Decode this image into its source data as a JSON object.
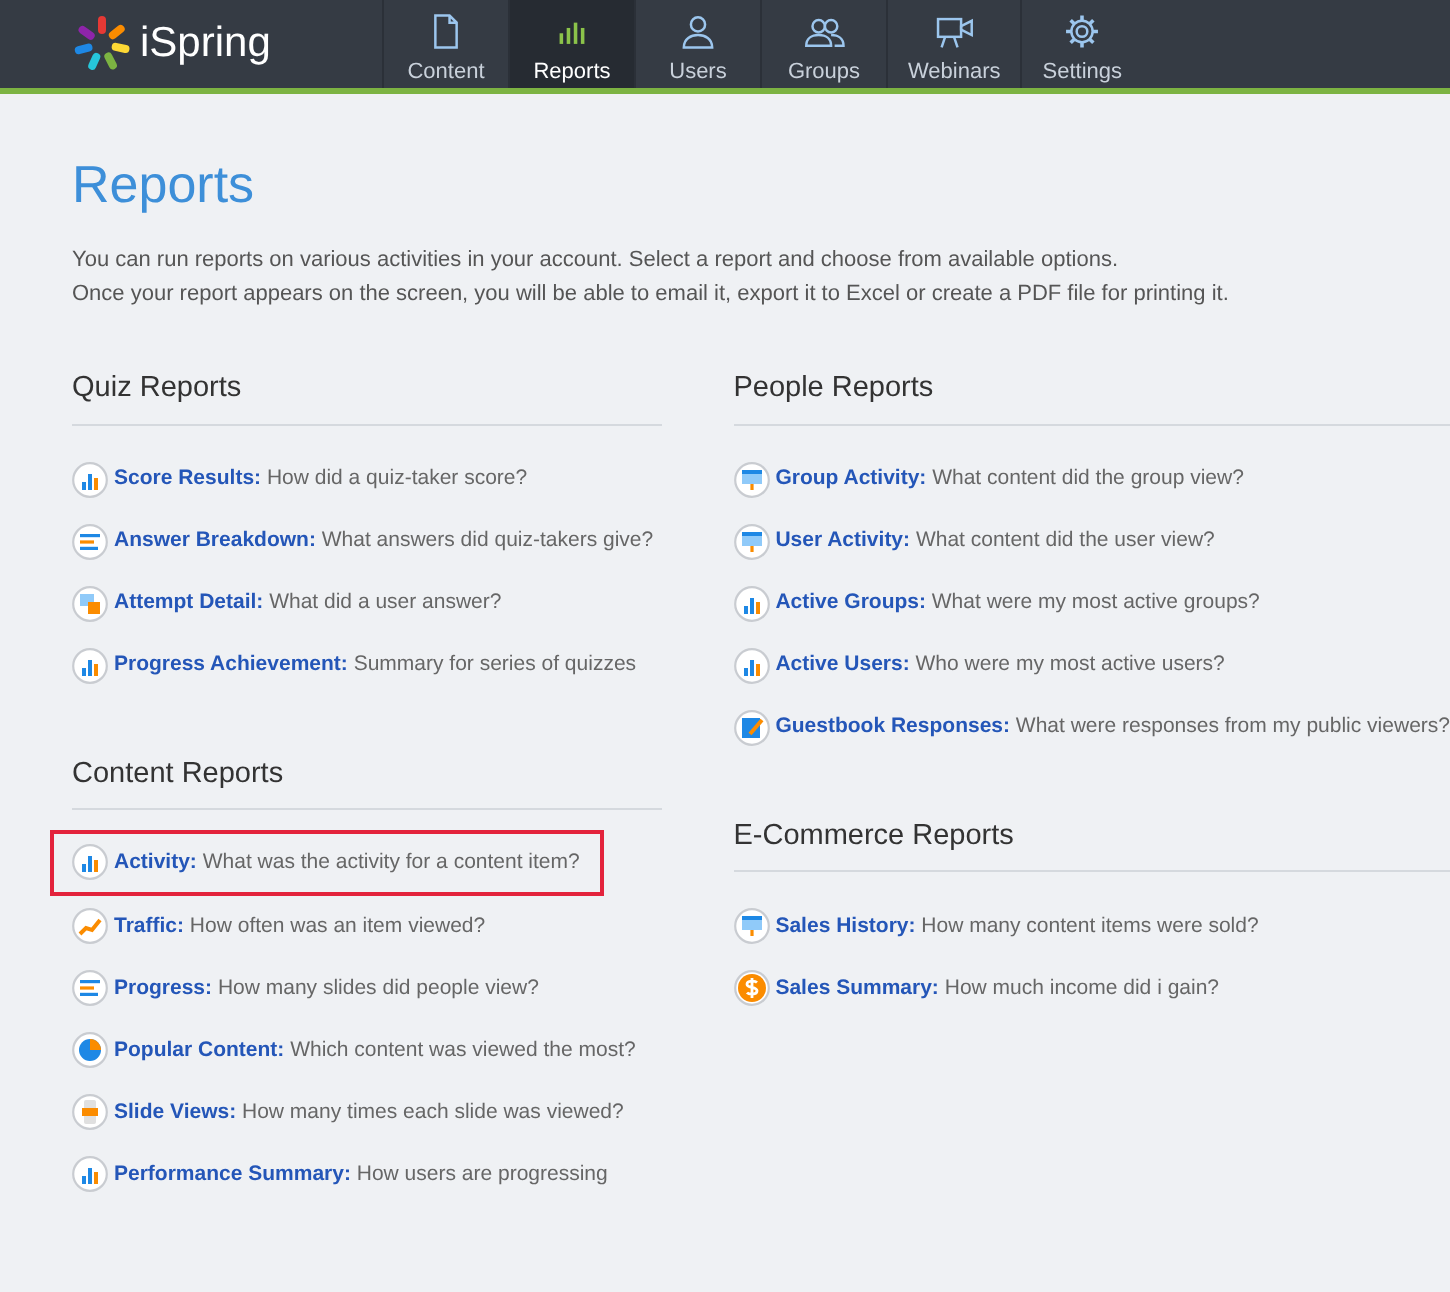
{
  "brand": {
    "name": "iSpring"
  },
  "nav": [
    {
      "label": "Content",
      "selected": false
    },
    {
      "label": "Reports",
      "selected": true
    },
    {
      "label": "Users",
      "selected": false
    },
    {
      "label": "Groups",
      "selected": false
    },
    {
      "label": "Webinars",
      "selected": false
    },
    {
      "label": "Settings",
      "selected": false
    }
  ],
  "page": {
    "title": "Reports",
    "intro": [
      "You can run reports on various activities in your account. Select a report and choose from available options.",
      "Once your report appears on the screen, you will be able to email it, export it to Excel or create a PDF file for printing it."
    ]
  },
  "columns": [
    [
      {
        "heading": "Quiz Reports",
        "reports": [
          {
            "title": "Score Results:",
            "description": " How did a quiz-taker score?",
            "kind": "bars",
            "highlighted": false
          },
          {
            "title": "Answer Breakdown:",
            "description": " What answers did quiz-takers give?",
            "kind": "lines",
            "highlighted": false
          },
          {
            "title": "Attempt Detail:",
            "description": " What did a user answer?",
            "kind": "attempt",
            "highlighted": false
          },
          {
            "title": "Progress Achievement:",
            "description": " Summary for series of quizzes",
            "kind": "bars",
            "highlighted": false
          }
        ]
      },
      {
        "heading": "Content Reports",
        "reports": [
          {
            "title": "Activity:",
            "description": " What was the activity for a content item?",
            "kind": "bars",
            "highlighted": true
          },
          {
            "title": "Traffic:",
            "description": " How often was an item viewed?",
            "kind": "trend",
            "highlighted": false
          },
          {
            "title": "Progress:",
            "description": " How many slides did people view?",
            "kind": "lines",
            "highlighted": false
          },
          {
            "title": "Popular Content:",
            "description": " Which content was viewed the most?",
            "kind": "pie",
            "highlighted": false
          },
          {
            "title": "Slide Views:",
            "description": " How many times each slide was viewed?",
            "kind": "slide",
            "highlighted": false
          },
          {
            "title": "Performance Summary:",
            "description": " How users are progressing",
            "kind": "bars",
            "highlighted": false
          }
        ]
      }
    ],
    [
      {
        "heading": "People Reports",
        "reports": [
          {
            "title": "Group Activity:",
            "description": " What content did the group view?",
            "kind": "screen",
            "highlighted": false
          },
          {
            "title": "User Activity:",
            "description": " What content did the user view?",
            "kind": "screen",
            "highlighted": false
          },
          {
            "title": "Active Groups:",
            "description": " What were my most active groups?",
            "kind": "bars",
            "highlighted": false
          },
          {
            "title": "Active Users:",
            "description": " Who were my most active users?",
            "kind": "bars",
            "highlighted": false
          },
          {
            "title": "Guestbook Responses:",
            "description": " What were responses from my public viewers?",
            "kind": "guestbook",
            "highlighted": false
          }
        ]
      },
      {
        "heading": "E-Commerce Reports",
        "reports": [
          {
            "title": "Sales History:",
            "description": " How many content items were sold?",
            "kind": "screen",
            "highlighted": false
          },
          {
            "title": "Sales Summary:",
            "description": " How much income did i gain?",
            "kind": "dollar",
            "highlighted": false
          }
        ]
      }
    ]
  ]
}
